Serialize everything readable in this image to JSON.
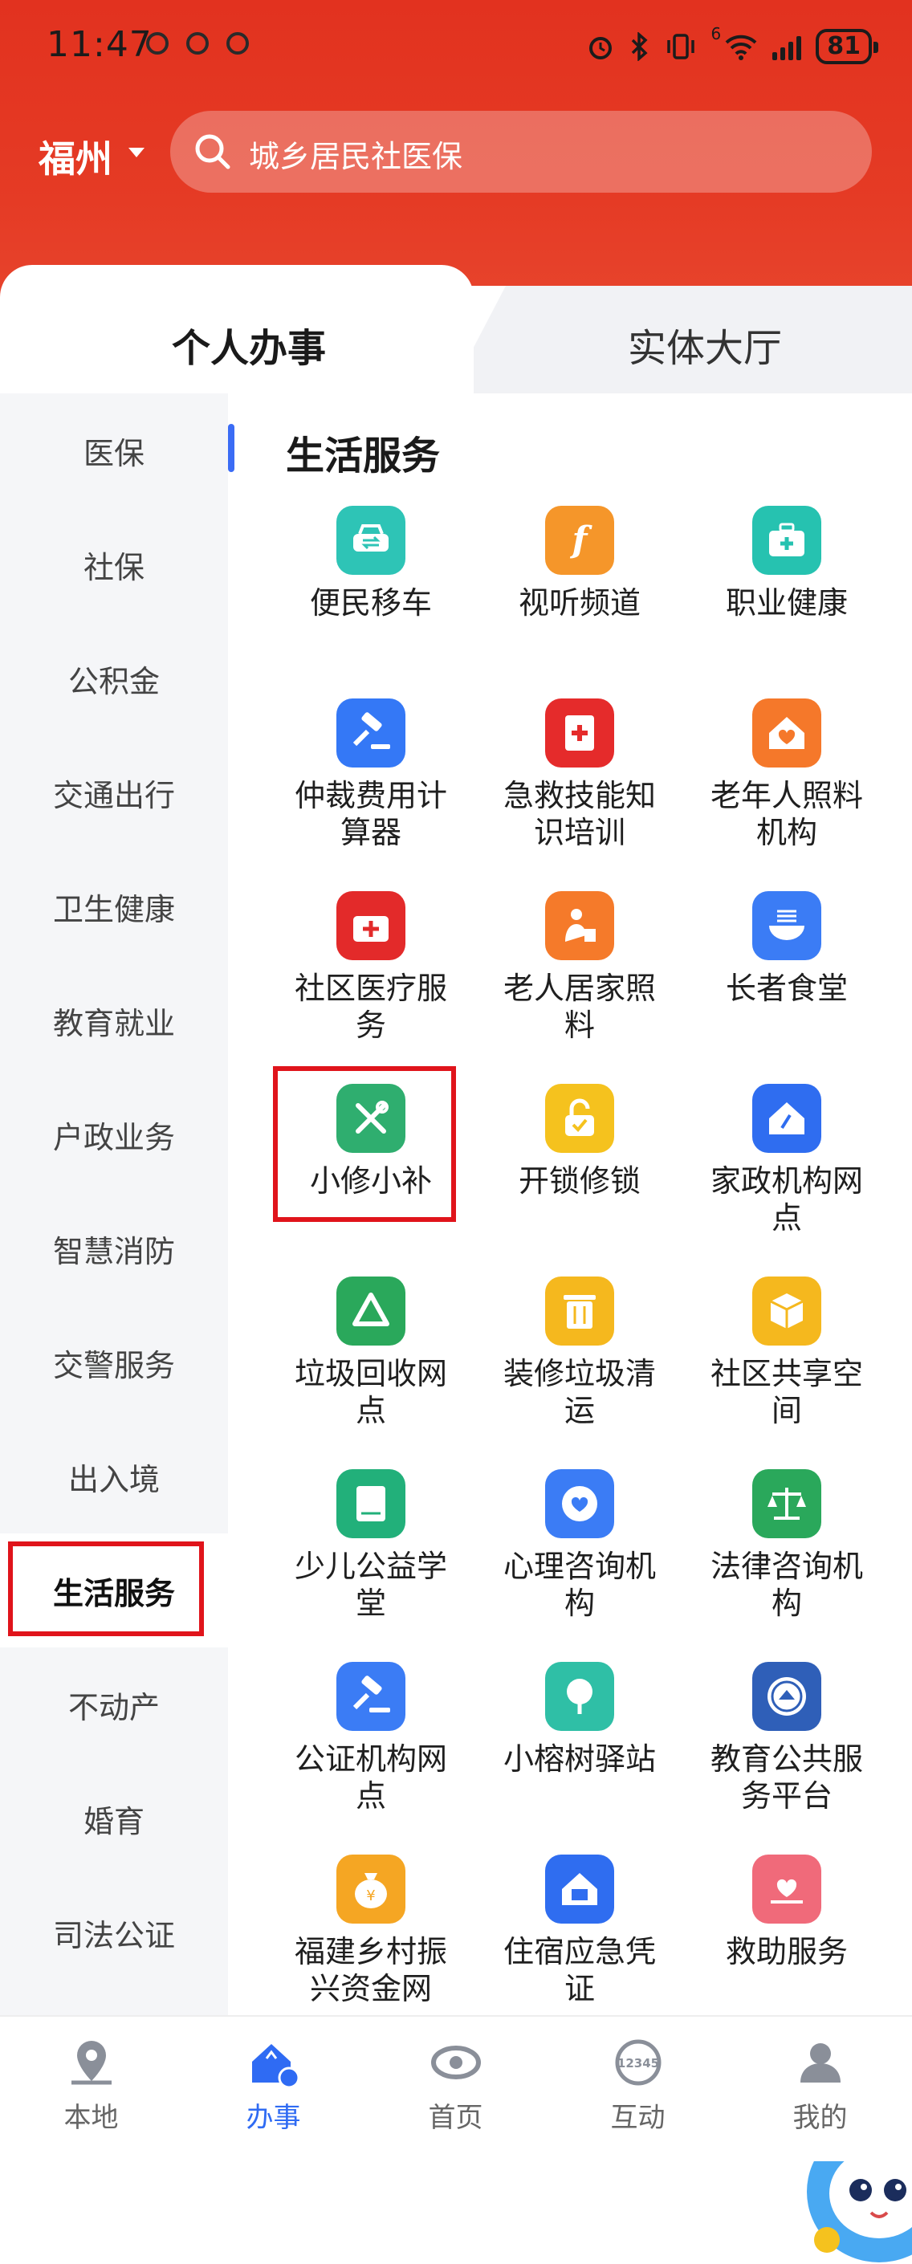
{
  "status_bar": {
    "time": "11:47",
    "network_label": "6",
    "battery": "81"
  },
  "header": {
    "city": "福州",
    "search_placeholder": "城乡居民社医保"
  },
  "tabs": {
    "active": "个人办事",
    "inactive": "实体大厅"
  },
  "sidebar": {
    "items": [
      {
        "label": "医保"
      },
      {
        "label": "社保"
      },
      {
        "label": "公积金"
      },
      {
        "label": "交通出行"
      },
      {
        "label": "卫生健康"
      },
      {
        "label": "教育就业"
      },
      {
        "label": "户政业务"
      },
      {
        "label": "智慧消防"
      },
      {
        "label": "交警服务"
      },
      {
        "label": "出入境"
      },
      {
        "label": "生活服务"
      },
      {
        "label": "不动产"
      },
      {
        "label": "婚育"
      },
      {
        "label": "司法公证"
      }
    ],
    "active_index": 10
  },
  "section": {
    "title": "生活服务"
  },
  "services": [
    {
      "label": "便民移车",
      "icon": "car-swap-icon",
      "color": "#2ec4b6"
    },
    {
      "label": "视听频道",
      "icon": "media-f-icon",
      "color": "#f5962a"
    },
    {
      "label": "职业健康",
      "icon": "medkit-icon",
      "color": "#26c2b0"
    },
    {
      "label": "仲裁费用计算器",
      "icon": "gavel-icon",
      "color": "#3478f6"
    },
    {
      "label": "急救技能知识培训",
      "icon": "first-aid-card-icon",
      "color": "#e52b2b"
    },
    {
      "label": "老年人照料机构",
      "icon": "heart-house-icon",
      "color": "#f5782a"
    },
    {
      "label": "社区医疗服务",
      "icon": "medical-bag-icon",
      "color": "#e32a2a"
    },
    {
      "label": "老人居家照料",
      "icon": "elder-care-icon",
      "color": "#f57a2a"
    },
    {
      "label": "长者食堂",
      "icon": "bowl-icon",
      "color": "#3b7cf5"
    },
    {
      "label": "小修小补",
      "icon": "tools-icon",
      "color": "#2fae6f"
    },
    {
      "label": "开锁修锁",
      "icon": "lock-icon",
      "color": "#f5c21e"
    },
    {
      "label": "家政机构网点",
      "icon": "house-clean-icon",
      "color": "#2f6df0"
    },
    {
      "label": "垃圾回收网点",
      "icon": "recycle-icon",
      "color": "#2aa85b"
    },
    {
      "label": "装修垃圾清运",
      "icon": "trash-icon",
      "color": "#f5b81e"
    },
    {
      "label": "社区共享空间",
      "icon": "cube-icon",
      "color": "#f5b81e"
    },
    {
      "label": "少儿公益学堂",
      "icon": "book-icon",
      "color": "#22b07a"
    },
    {
      "label": "心理咨询机构",
      "icon": "phone-heart-icon",
      "color": "#3b7cf5"
    },
    {
      "label": "法律咨询机构",
      "icon": "scale-icon",
      "color": "#2aa85b"
    },
    {
      "label": "公证机构网点",
      "icon": "notary-gavel-icon",
      "color": "#3b7cf5"
    },
    {
      "label": "小榕树驿站",
      "icon": "banyan-tree-icon",
      "color": "#2fbfa6"
    },
    {
      "label": "教育公共服务平台",
      "icon": "edu-seal-icon",
      "color": "#2f5fb8"
    },
    {
      "label": "福建乡村振兴资金网",
      "icon": "money-bag-icon",
      "color": "#f5a623"
    },
    {
      "label": "住宿应急凭证",
      "icon": "emergency-house-icon",
      "color": "#2f6df0"
    },
    {
      "label": "救助服务",
      "icon": "helping-hand-icon",
      "color": "#f06a7a"
    }
  ],
  "bottom_nav": [
    {
      "label": "本地",
      "icon": "location-pin-icon"
    },
    {
      "label": "办事",
      "icon": "service-house-icon"
    },
    {
      "label": "首页",
      "icon": "home-eye-icon"
    },
    {
      "label": "互动",
      "icon": "hotline-12345-icon",
      "badge_text": "12345"
    },
    {
      "label": "我的",
      "icon": "user-icon"
    }
  ],
  "colors": {
    "header_red": "#e2321f",
    "accent_blue": "#2f6bf3",
    "highlight_red": "#e0141b"
  }
}
